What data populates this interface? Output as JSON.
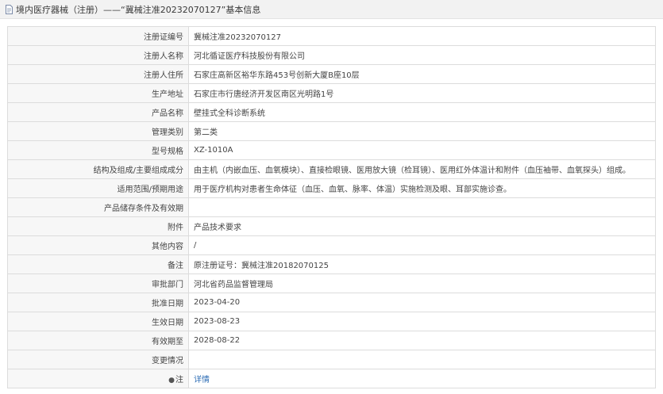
{
  "header": {
    "title": "境内医疗器械（注册）——“冀械注准20232070127”基本信息"
  },
  "rows": [
    {
      "label": "注册证编号",
      "value": "冀械注准20232070127"
    },
    {
      "label": "注册人名称",
      "value": "河北循证医疗科技股份有限公司"
    },
    {
      "label": "注册人住所",
      "value": "石家庄高新区裕华东路453号创新大厦B座10层"
    },
    {
      "label": "生产地址",
      "value": "石家庄市行唐经济开发区南区光明路1号"
    },
    {
      "label": "产品名称",
      "value": "壁挂式全科诊断系统"
    },
    {
      "label": "管理类别",
      "value": "第二类"
    },
    {
      "label": "型号规格",
      "value": "XZ-1010A"
    },
    {
      "label": "结构及组成/主要组成成分",
      "value": "由主机（内嵌血压、血氧模块）、直接检眼镜、医用放大镜（检耳镜）、医用红外体温计和附件（血压袖带、血氧探头）组成。"
    },
    {
      "label": "适用范围/预期用途",
      "value": "用于医疗机构对患者生命体征（血压、血氧、脉率、体温）实施检测及眼、耳部实施诊查。"
    },
    {
      "label": "产品储存条件及有效期",
      "value": ""
    },
    {
      "label": "附件",
      "value": "产品技术要求"
    },
    {
      "label": "其他内容",
      "value": "/"
    },
    {
      "label": "备注",
      "value": "原注册证号：冀械注准20182070125"
    },
    {
      "label": "审批部门",
      "value": "河北省药品监督管理局"
    },
    {
      "label": "批准日期",
      "value": "2023-04-20"
    },
    {
      "label": "生效日期",
      "value": "2023-08-23"
    },
    {
      "label": "有效期至",
      "value": "2028-08-22"
    },
    {
      "label": "变更情况",
      "value": ""
    }
  ],
  "note_row": {
    "icon": "note-icon",
    "label": "注",
    "link_label": "详情"
  }
}
